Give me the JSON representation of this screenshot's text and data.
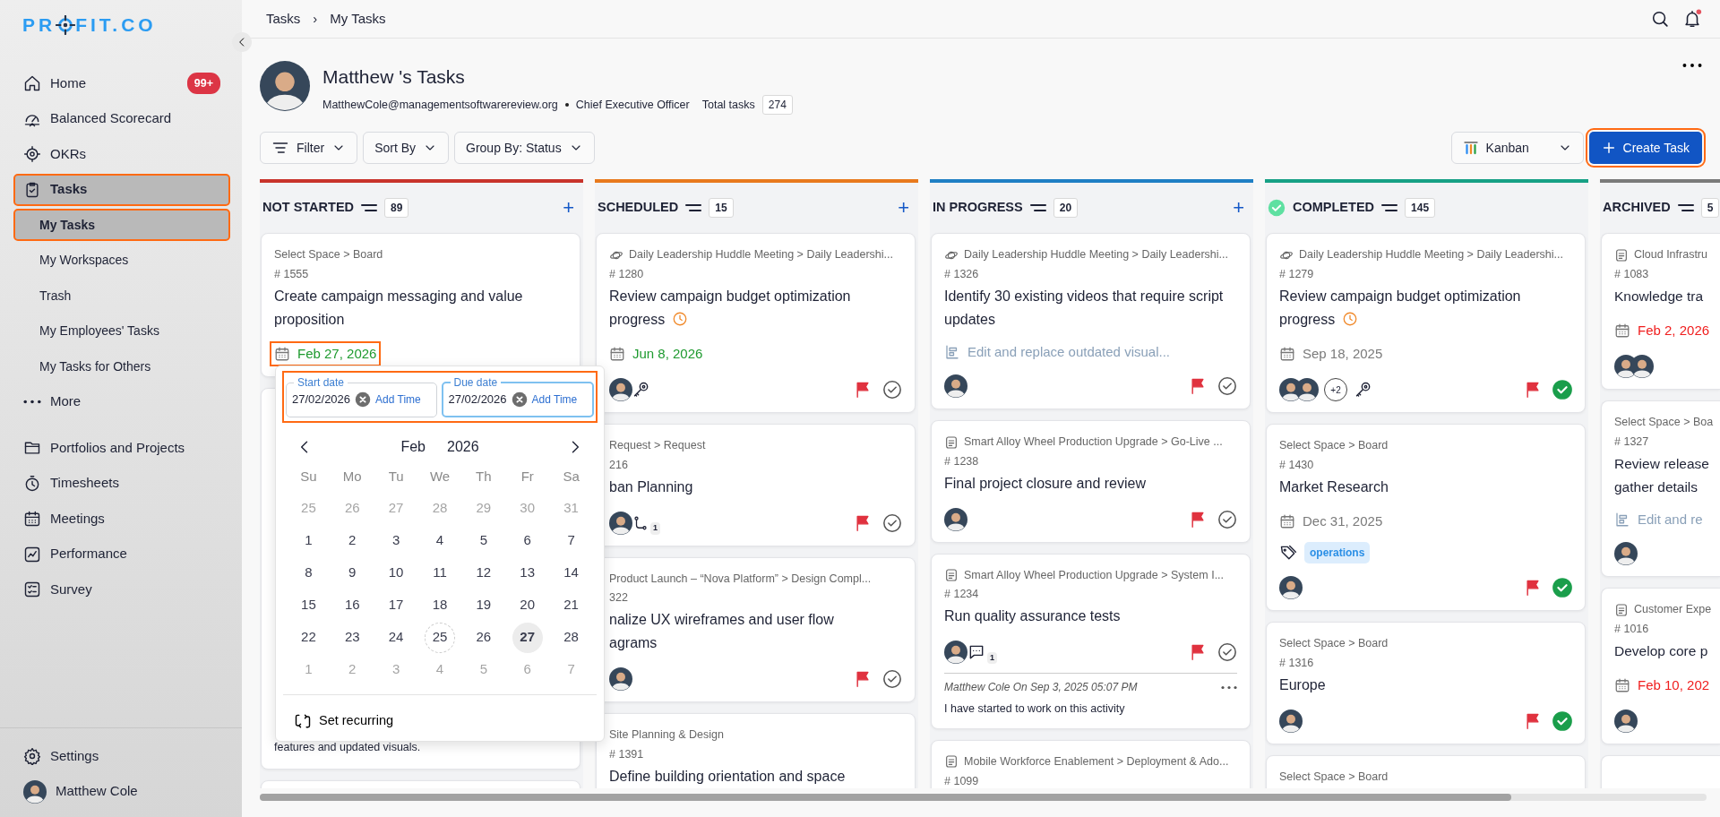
{
  "sidebar": {
    "logo": {
      "before": "PR",
      "after": "FIT.CO"
    },
    "sections": [
      [
        {
          "label": "Home",
          "badge": "99+",
          "selected": false,
          "highlighted": false
        },
        {
          "label": "Balanced Scorecard",
          "selected": false,
          "highlighted": false
        },
        {
          "label": "OKRs",
          "selected": false,
          "highlighted": false
        },
        {
          "label": "Tasks",
          "selected": true,
          "highlighted": true,
          "children": [
            {
              "label": "My Tasks",
              "selected": true,
              "highlighted": true
            },
            {
              "label": "My Workspaces",
              "selected": false,
              "highlighted": false
            },
            {
              "label": "Trash",
              "selected": false,
              "highlighted": false
            },
            {
              "label": "My Employees' Tasks",
              "selected": false,
              "highlighted": false
            },
            {
              "label": "My Tasks for Others",
              "selected": false,
              "highlighted": false
            }
          ]
        },
        {
          "label": "More",
          "selected": false,
          "highlighted": false
        }
      ],
      [
        {
          "label": "Portfolios and Projects",
          "selected": false,
          "highlighted": false
        },
        {
          "label": "Timesheets",
          "selected": false,
          "highlighted": false
        },
        {
          "label": "Meetings",
          "selected": false,
          "highlighted": false
        },
        {
          "label": "Performance",
          "selected": false,
          "highlighted": false
        },
        {
          "label": "Survey",
          "selected": false,
          "highlighted": false
        }
      ]
    ],
    "settings": "Settings",
    "user": "Matthew Cole"
  },
  "breadcrumb": {
    "items": [
      "Tasks",
      "My Tasks"
    ],
    "separator": "›"
  },
  "profile": {
    "title": "Matthew 's Tasks",
    "email": "MatthewCole@managementsoftwarereview.org",
    "role": "Chief Executive Officer",
    "total_label": "Total tasks",
    "total": "274"
  },
  "toolbar": {
    "buttons": [
      "Filter",
      "Sort By",
      "Group By: Status"
    ],
    "view": "Kanban",
    "create": {
      "label": "Create Task",
      "highlighted": true
    }
  },
  "columns": [
    {
      "title": "NOT STARTED",
      "count": "89",
      "color": "#c8332b",
      "add": "+",
      "check": false,
      "cards": [
        {
          "kind": "task",
          "path": {
            "kind": "space",
            "text": "Select Space > Board"
          },
          "number": "# 1555",
          "title": "Create campaign messaging and value proposition",
          "date": {
            "text": "Feb 27, 2026",
            "color": "#1e9a2f",
            "highlighted": true
          }
        },
        {
          "kind": "covered",
          "description": "features and updated visuals."
        },
        {
          "kind": "covered"
        }
      ]
    },
    {
      "title": "SCHEDULED",
      "count": "15",
      "color": "#e8791d",
      "add": "+",
      "check": false,
      "cards": [
        {
          "kind": "task",
          "path": {
            "kind": "meeting",
            "text": "Daily Leadership Huddle Meeting > Daily Leadershi..."
          },
          "number": "# 1280",
          "title": "Review campaign budget optimization progress",
          "clock": true,
          "date": {
            "text": "Jun 8, 2026",
            "color": "#1e9a2f",
            "highlighted": false
          },
          "avatars": [
            {
              "kind": "photo"
            }
          ],
          "key": true,
          "flagged": true,
          "done": false
        },
        {
          "kind": "task",
          "path": {
            "kind": "space",
            "text": "Request > Request"
          },
          "number": "216",
          "title": "ban Planning",
          "avatars": [
            {
              "kind": "photo"
            }
          ],
          "subtasks": "1",
          "flagged": true,
          "done": false
        },
        {
          "kind": "task",
          "path": {
            "kind": "space",
            "text": "Product Launch – “Nova Platform” > Design Compl..."
          },
          "number": "322",
          "title": "nalize UX wireframes and user flow\nagrams",
          "avatars": [
            {
              "kind": "photo"
            }
          ],
          "flagged": true,
          "done": false
        },
        {
          "kind": "task",
          "path": {
            "kind": "space",
            "text": "Site Planning & Design"
          },
          "number": "# 1391",
          "title": "Define building orientation and space"
        }
      ]
    },
    {
      "title": "IN PROGRESS",
      "count": "20",
      "color": "#1f7fc4",
      "add": "+",
      "check": false,
      "cards": [
        {
          "kind": "task",
          "path": {
            "kind": "meeting",
            "text": "Daily Leadership Huddle Meeting > Daily Leadershi..."
          },
          "number": "# 1326",
          "title": "Identify 30 existing videos that require script\nupdates",
          "subtask_link": "Edit and replace outdated visual...",
          "avatars": [
            {
              "kind": "photo"
            }
          ],
          "flagged": true,
          "done": false
        },
        {
          "kind": "task",
          "path": {
            "kind": "project",
            "text": "Smart Alloy Wheel Production Upgrade > Go-Live ..."
          },
          "number": "# 1238",
          "title": "Final project closure and review",
          "avatars": [
            {
              "kind": "photo"
            }
          ],
          "flagged": true,
          "done": false
        },
        {
          "kind": "task",
          "path": {
            "kind": "project",
            "text": "Smart Alloy Wheel Production Upgrade > System I..."
          },
          "number": "# 1234",
          "title": "Run quality assurance tests",
          "avatars": [
            {
              "kind": "photo"
            }
          ],
          "comments": "1",
          "flagged": true,
          "done": false,
          "comment": {
            "meta": "Matthew Cole On Sep 3, 2025 05:07 PM",
            "text": "I have started to work on this activity"
          }
        },
        {
          "kind": "task",
          "path": {
            "kind": "project",
            "text": "Mobile Workforce Enablement > Deployment & Ado..."
          },
          "number": "# 1099"
        }
      ]
    },
    {
      "title": "COMPLETED",
      "count": "145",
      "color": "#17a085",
      "check": true,
      "cards": [
        {
          "kind": "task",
          "path": {
            "kind": "meeting",
            "text": "Daily Leadership Huddle Meeting > Daily Leadershi..."
          },
          "number": "# 1279",
          "title": "Review campaign budget optimization\nprogress",
          "clock": true,
          "date": {
            "text": "Sep 18, 2025",
            "color": "#7a7a7a",
            "highlighted": false
          },
          "avatars": [
            {
              "kind": "photo"
            },
            {
              "kind": "photo"
            }
          ],
          "extra": "+2",
          "key": true,
          "flagged": true,
          "done": true
        },
        {
          "kind": "task",
          "path": {
            "kind": "space",
            "text": "Select Space > Board"
          },
          "number": "# 1430",
          "title": "Market Research",
          "date": {
            "text": "Dec 31, 2025",
            "color": "#7a7a7a",
            "highlighted": false
          },
          "tags": [
            "operations"
          ],
          "avatars": [
            {
              "kind": "photo"
            }
          ],
          "flagged": true,
          "done": true
        },
        {
          "kind": "task",
          "path": {
            "kind": "space",
            "text": "Select Space > Board"
          },
          "number": "# 1316",
          "title": "Europe",
          "avatars": [
            {
              "kind": "photo"
            }
          ],
          "flagged": true,
          "done": true
        },
        {
          "kind": "task",
          "path": {
            "kind": "space",
            "text": "Select Space > Board"
          }
        }
      ]
    },
    {
      "title": "ARCHIVED",
      "count": "5",
      "color": "#7a7a7a",
      "check": false,
      "cards": [
        {
          "kind": "task",
          "path": {
            "kind": "project",
            "text": "Cloud Infrastru"
          },
          "number": "# 1083",
          "title": "Knowledge tra",
          "date": {
            "text": "Feb 2, 2026",
            "color": "#f01e1e",
            "highlighted": false
          },
          "avatars": [
            {
              "kind": "photo"
            },
            {
              "kind": "photo"
            }
          ]
        },
        {
          "kind": "task",
          "path": {
            "kind": "space",
            "text": "Select Space > Boa"
          },
          "number": "# 1327",
          "title": "Review release\ngather details",
          "subtask_link": "Edit and re",
          "avatars": [
            {
              "kind": "photo"
            }
          ]
        },
        {
          "kind": "task",
          "path": {
            "kind": "project",
            "text": "Customer Expe"
          },
          "number": "# 1016",
          "title": "Develop core p",
          "date": {
            "text": "Feb 10, 202",
            "color": "#f01e1e",
            "highlighted": false
          },
          "avatars": [
            {
              "kind": "photo"
            }
          ]
        },
        {
          "kind": "covered"
        }
      ]
    }
  ],
  "date_picker": {
    "fields_highlighted": true,
    "start": {
      "label": "Start date",
      "value": "27/02/2026",
      "add_time": "Add Time",
      "focused": false
    },
    "due": {
      "label": "Due date",
      "value": "27/02/2026",
      "add_time": "Add Time",
      "focused": true
    },
    "month": "Feb",
    "year": "2026",
    "weekdays": [
      "Su",
      "Mo",
      "Tu",
      "We",
      "Th",
      "Fr",
      "Sa"
    ],
    "weeks": [
      [
        {
          "text": "25",
          "muted": true,
          "selected": false,
          "today": false
        },
        {
          "text": "26",
          "muted": true,
          "selected": false,
          "today": false
        },
        {
          "text": "27",
          "muted": true,
          "selected": false,
          "today": false
        },
        {
          "text": "28",
          "muted": true,
          "selected": false,
          "today": false
        },
        {
          "text": "29",
          "muted": true,
          "selected": false,
          "today": false
        },
        {
          "text": "30",
          "muted": true,
          "selected": false,
          "today": false
        },
        {
          "text": "31",
          "muted": true,
          "selected": false,
          "today": false
        }
      ],
      [
        {
          "text": "1",
          "muted": false,
          "selected": false,
          "today": false
        },
        {
          "text": "2",
          "muted": false,
          "selected": false,
          "today": false
        },
        {
          "text": "3",
          "muted": false,
          "selected": false,
          "today": false
        },
        {
          "text": "4",
          "muted": false,
          "selected": false,
          "today": false
        },
        {
          "text": "5",
          "muted": false,
          "selected": false,
          "today": false
        },
        {
          "text": "6",
          "muted": false,
          "selected": false,
          "today": false
        },
        {
          "text": "7",
          "muted": false,
          "selected": false,
          "today": false
        }
      ],
      [
        {
          "text": "8",
          "muted": false,
          "selected": false,
          "today": false
        },
        {
          "text": "9",
          "muted": false,
          "selected": false,
          "today": false
        },
        {
          "text": "10",
          "muted": false,
          "selected": false,
          "today": false
        },
        {
          "text": "11",
          "muted": false,
          "selected": false,
          "today": false
        },
        {
          "text": "12",
          "muted": false,
          "selected": false,
          "today": false
        },
        {
          "text": "13",
          "muted": false,
          "selected": false,
          "today": false
        },
        {
          "text": "14",
          "muted": false,
          "selected": false,
          "today": false
        }
      ],
      [
        {
          "text": "15",
          "muted": false,
          "selected": false,
          "today": false
        },
        {
          "text": "16",
          "muted": false,
          "selected": false,
          "today": false
        },
        {
          "text": "17",
          "muted": false,
          "selected": false,
          "today": false
        },
        {
          "text": "18",
          "muted": false,
          "selected": false,
          "today": false
        },
        {
          "text": "19",
          "muted": false,
          "selected": false,
          "today": false
        },
        {
          "text": "20",
          "muted": false,
          "selected": false,
          "today": false
        },
        {
          "text": "21",
          "muted": false,
          "selected": false,
          "today": false
        }
      ],
      [
        {
          "text": "22",
          "muted": false,
          "selected": false,
          "today": false
        },
        {
          "text": "23",
          "muted": false,
          "selected": false,
          "today": false
        },
        {
          "text": "24",
          "muted": false,
          "selected": false,
          "today": false
        },
        {
          "text": "25",
          "muted": false,
          "selected": false,
          "today": true
        },
        {
          "text": "26",
          "muted": false,
          "selected": false,
          "today": false
        },
        {
          "text": "27",
          "muted": false,
          "selected": true,
          "today": false
        },
        {
          "text": "28",
          "muted": false,
          "selected": false,
          "today": false
        }
      ],
      [
        {
          "text": "1",
          "muted": true,
          "selected": false,
          "today": false
        },
        {
          "text": "2",
          "muted": true,
          "selected": false,
          "today": false
        },
        {
          "text": "3",
          "muted": true,
          "selected": false,
          "today": false
        },
        {
          "text": "4",
          "muted": true,
          "selected": false,
          "today": false
        },
        {
          "text": "5",
          "muted": true,
          "selected": false,
          "today": false
        },
        {
          "text": "6",
          "muted": true,
          "selected": false,
          "today": false
        },
        {
          "text": "7",
          "muted": true,
          "selected": false,
          "today": false
        }
      ]
    ],
    "recurring": "Set recurring"
  }
}
